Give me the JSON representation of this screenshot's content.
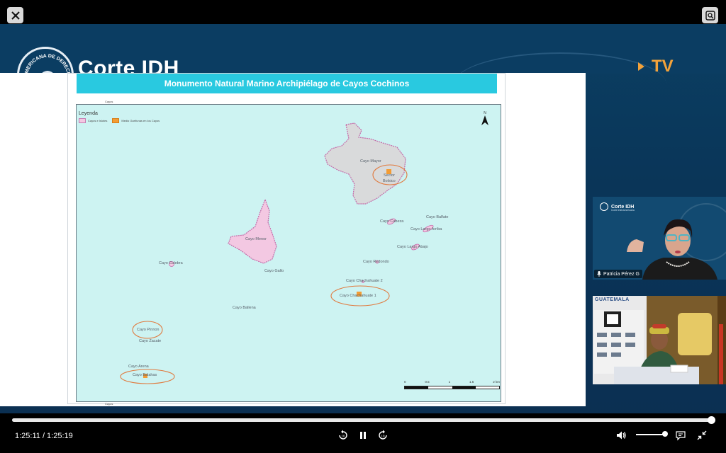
{
  "player": {
    "time_display": "1:25:11 / 1:25:19",
    "progress_fraction": 0.9984,
    "volume_fraction": 0.95
  },
  "broadcast": {
    "brand_name": "Corte IDH",
    "seal_text": "AMERICANA DE DERECHOS",
    "tv_label": "TV"
  },
  "map": {
    "title": "Monumento Natural Marino Archipiélago de Cayos Cochinos",
    "legend_title": "Leyenda",
    "legend_item_1": "Cayos e Islotes",
    "legend_item_2": "Medio Garífunas en los Cayos",
    "north_label": "N",
    "tiny_top": "Cayos",
    "tiny_bottom": "Cayos",
    "labels": {
      "cayo_mayor": "Cayo Mayor",
      "sector": "Sector",
      "bolsico": "Bolsico",
      "cayo_menor": "Cayo Menor",
      "cayo_culebra": "Cayo Culebra",
      "cayo_gallo": "Cayo Gallo",
      "cayo_ballena": "Cayo Ballena",
      "cayo_pinnon": "Cayo Pinnon",
      "cayo_zacate": "Cayo Zacate",
      "cayo_arena": "Cayo Arena",
      "cayo_balahas": "Cayo Balahas",
      "cayo_cabeza": "Cayo Cabeza",
      "cayo_balfate": "Cayo Balfate",
      "cayo_largo_arriba": "Cayo Largo Arriba",
      "cayo_largo_abajo": "Cayo Largo Abajo",
      "cayo_redondo": "Cayo Redondo",
      "cayo_chachahuate_2": "Cayo Chachahuate 2",
      "cayo_chachahuate_1": "Cayo Chachahuate 1"
    },
    "scale_labels": [
      "0",
      "0.5",
      "1",
      "1.5",
      "2 km"
    ]
  },
  "participants": {
    "speaker_name": "Patricia Pérez G",
    "speaker_logo_text": "Corte IDH",
    "speaker_logo_sub": "Corte Interamericana",
    "room_banner": "GUATEMALA"
  },
  "colors": {
    "accent": "#29c9e0",
    "sea": "#cdf3f2",
    "island_fill": "#f3c8e2",
    "island_stroke": "#c46aa8",
    "garifuna": "#f39c34",
    "tv_orange": "#f3a23a",
    "broadcast_bg": "#0b3d62"
  },
  "icons": {
    "close": "close-icon",
    "zoom": "zoom-icon",
    "rewind": "rewind-10-icon",
    "pause": "pause-icon",
    "forward": "forward-10-icon",
    "volume": "volume-icon",
    "captions": "captions-icon",
    "collapse": "collapse-icon"
  }
}
